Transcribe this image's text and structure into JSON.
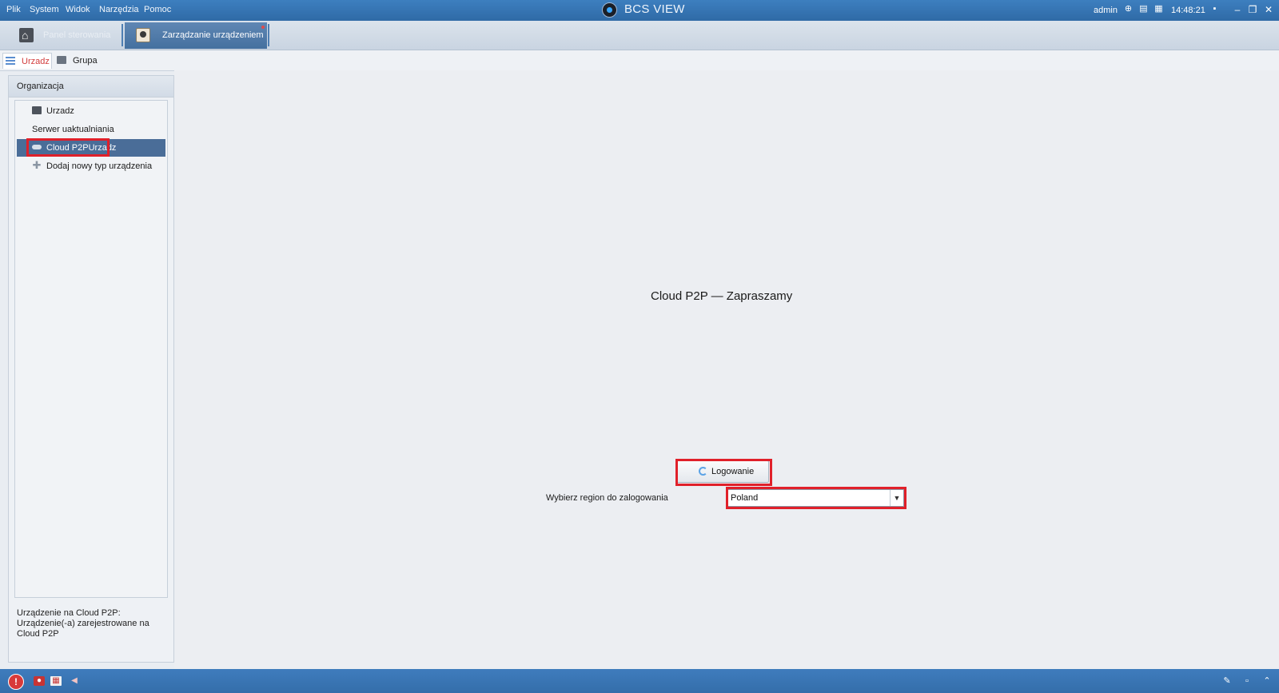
{
  "titlebar": {
    "menu": [
      "Plik",
      "System",
      "Widok",
      "Narzędzia",
      "Pomoc"
    ],
    "app_title": "BCS VIEW",
    "user": "admin",
    "clock": "14:48:21"
  },
  "tabs": {
    "dashboard": "Panel sterowania",
    "device_management": "Zarządzanie urządzeniem"
  },
  "subtabs": {
    "device": "Urzadz",
    "group": "Grupa"
  },
  "left_panel": {
    "header": "Organizacja",
    "tree": {
      "device": "Urzadz",
      "update_server": "Serwer uaktualniania",
      "cloud": "Cloud P2PUrzadz",
      "add_type": "Dodaj nowy typ urządzenia"
    },
    "description": "Urządzenie na Cloud P2P: Urządzenie(-a) zarejestrowane na Cloud P2P"
  },
  "main": {
    "welcome": "Cloud P2P — Zapraszamy",
    "login_button": "Logowanie",
    "region_label": "Wybierz region do zalogowania",
    "region_value": "Poland"
  },
  "colors": {
    "titlebar": "#2f6aa6",
    "active_tab": "#44709f",
    "highlight": "#e0202a",
    "selected_tree": "#4a6d98"
  }
}
